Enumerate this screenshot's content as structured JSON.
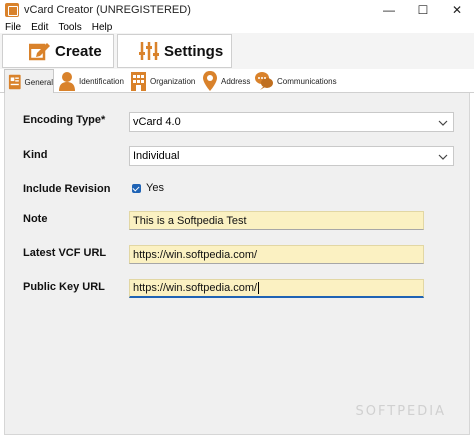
{
  "window": {
    "title": "vCard Creator (UNREGISTERED)",
    "controls": {
      "minimize": "—",
      "maximize": "☐",
      "close": "✕"
    }
  },
  "menu": {
    "items": [
      {
        "label": "File"
      },
      {
        "label": "Edit"
      },
      {
        "label": "Tools"
      },
      {
        "label": "Help"
      }
    ]
  },
  "toolbar": {
    "create_label": "Create",
    "settings_label": "Settings"
  },
  "tabs": [
    {
      "label": "General",
      "icon": "id-card-icon",
      "active": true
    },
    {
      "label": "Identification",
      "icon": "person-icon",
      "active": false
    },
    {
      "label": "Organization",
      "icon": "building-icon",
      "active": false
    },
    {
      "label": "Address",
      "icon": "location-pin-icon",
      "active": false
    },
    {
      "label": "Communications",
      "icon": "chat-bubbles-icon",
      "active": false
    }
  ],
  "form": {
    "encoding": {
      "label": "Encoding Type*",
      "value": "vCard 4.0"
    },
    "kind": {
      "label": "Kind",
      "value": "Individual"
    },
    "revision": {
      "label": "Include Revision",
      "checked": true,
      "option_label": "Yes"
    },
    "note": {
      "label": "Note",
      "value": "This is a Softpedia Test"
    },
    "latest_vcf_url": {
      "label": "Latest VCF URL",
      "value": "https://win.softpedia.com/"
    },
    "public_key_url": {
      "label": "Public Key URL",
      "value": "https://win.softpedia.com/"
    }
  },
  "watermark": "SOFTPEDIA",
  "colors": {
    "accent": "#d9822b",
    "input_bg": "#fbf1c2",
    "focus": "#1f63b5",
    "panel_bg": "#f0f0f0"
  }
}
